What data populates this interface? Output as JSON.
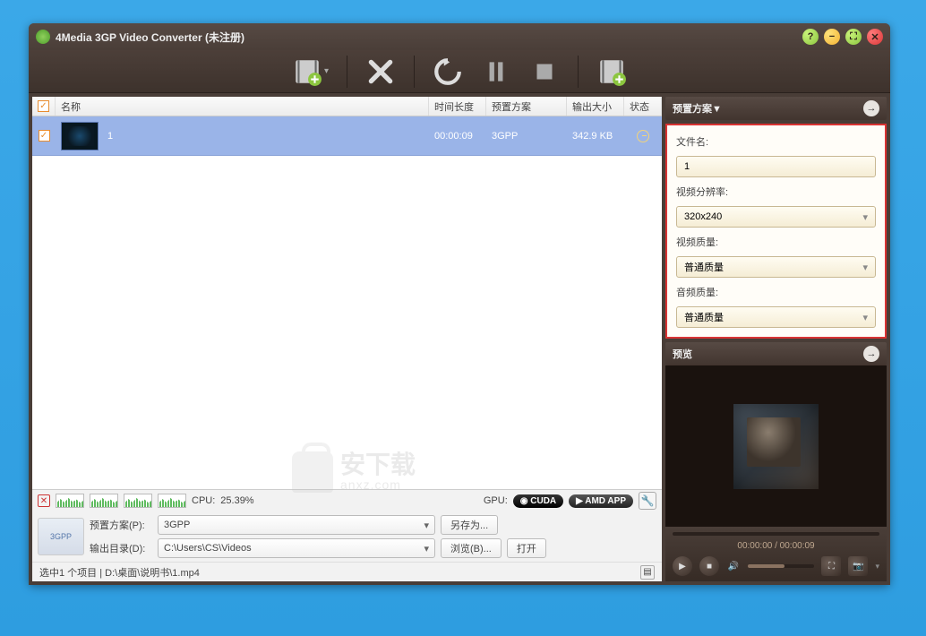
{
  "title": "4Media 3GP Video Converter (未注册)",
  "columns": {
    "name": "名称",
    "duration": "时间长度",
    "preset": "预置方案",
    "size": "输出大小",
    "status": "状态"
  },
  "row": {
    "name": "1",
    "duration": "00:00:09",
    "preset": "3GPP",
    "size": "342.9 KB"
  },
  "watermark": {
    "main": "安下载",
    "sub": "anxz.com"
  },
  "cpu": {
    "prefix": "CPU:",
    "value": "25.39%"
  },
  "gpu": {
    "label": "GPU:",
    "cuda": "◉ CUDA",
    "amd": "▶ AMD APP"
  },
  "config": {
    "thumb_label": "3GPP",
    "preset_label": "预置方案(P):",
    "preset_value": "3GPP",
    "saveas": "另存为...",
    "output_label": "输出目录(D):",
    "output_value": "C:\\Users\\CS\\Videos",
    "browse": "浏览(B)...",
    "open": "打开"
  },
  "status_line": "选中1 个项目 | D:\\桌面\\说明书\\1.mp4",
  "right": {
    "preset_title": "预置方案▼",
    "filename_label": "文件名:",
    "filename_value": "1",
    "resolution_label": "视频分辨率:",
    "resolution_value": "320x240",
    "vquality_label": "视频质量:",
    "vquality_value": "普通质量",
    "aquality_label": "音频质量:",
    "aquality_value": "普通质量",
    "preview_title": "预览",
    "time": "00:00:00 / 00:00:09"
  }
}
